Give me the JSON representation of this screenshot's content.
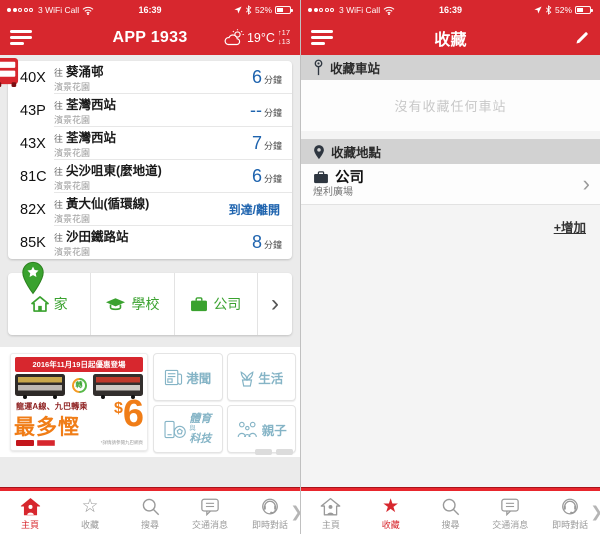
{
  "colors": {
    "brand_red": "#d7272e",
    "eta_blue": "#1e63ae",
    "green": "#3aa22f",
    "tile_blue": "#85b4c6",
    "banner_orange": "#f07d17"
  },
  "status": {
    "carrier": "3 WiFi Call",
    "time": "16:39",
    "battery": "52%"
  },
  "left": {
    "nav": {
      "title": "APP 1933",
      "temp": "19°C",
      "high": "↑17",
      "low": "↓13"
    },
    "routes": [
      {
        "number": "40X",
        "prefix": "往",
        "destination": "葵涌邨",
        "origin": "濱景花園",
        "eta": "6",
        "unit": "分鐘"
      },
      {
        "number": "43P",
        "prefix": "往",
        "destination": "荃灣西站",
        "origin": "濱景花園",
        "eta": "--",
        "unit": "分鐘"
      },
      {
        "number": "43X",
        "prefix": "往",
        "destination": "荃灣西站",
        "origin": "濱景花園",
        "eta": "7",
        "unit": "分鐘"
      },
      {
        "number": "81C",
        "prefix": "往",
        "destination": "尖沙咀東(麼地道)",
        "origin": "濱景花園",
        "eta": "6",
        "unit": "分鐘"
      },
      {
        "number": "82X",
        "prefix": "往",
        "destination": "黃大仙(循環線)",
        "origin": "濱景花園",
        "eta": "到達/離開",
        "unit": ""
      },
      {
        "number": "85K",
        "prefix": "往",
        "destination": "沙田鐵路站",
        "origin": "濱景花園",
        "eta": "8",
        "unit": "分鐘"
      }
    ],
    "shortcuts": [
      {
        "icon": "home-icon",
        "label": "家"
      },
      {
        "icon": "school-icon",
        "label": "學校"
      },
      {
        "icon": "briefcase-icon",
        "label": "公司"
      }
    ],
    "banner": {
      "headline": "2016年11月19日起優惠登場",
      "badge": "轉",
      "subline": "龍運A線、九巴轉乘",
      "tagline": "最多慳",
      "currency": "$",
      "price": "6",
      "disclaimer": "*詳情請參閱九巴網頁"
    },
    "tiles": [
      {
        "label": "港聞",
        "icon": "newspaper-icon"
      },
      {
        "label": "生活",
        "icon": "plant-icon"
      },
      {
        "top": "體育",
        "mid": "與",
        "bottom": "科技",
        "icon": "phone-ball-icon"
      },
      {
        "label": "親子",
        "icon": "family-icon"
      }
    ]
  },
  "right": {
    "nav": {
      "title": "收藏"
    },
    "stations_section": {
      "title": "收藏車站",
      "empty": "沒有收藏任何車站"
    },
    "places_section": {
      "title": "收藏地點",
      "item_title": "公司",
      "item_subtitle": "煌利廣場",
      "add": "+增加"
    }
  },
  "tabbar": {
    "items": [
      {
        "label": "主頁"
      },
      {
        "label": "收藏"
      },
      {
        "label": "搜尋"
      },
      {
        "label": "交通消息"
      },
      {
        "label": "即時對話"
      }
    ]
  },
  "icons": {
    "menu": "hamburger",
    "edit": "pencil",
    "weather": "sun-cloud",
    "station": "bus-stop-pin",
    "place": "map-pin",
    "company": "briefcase",
    "chevron": "›",
    "tabs": [
      "home",
      "star",
      "search",
      "chat-lines",
      "headset"
    ]
  }
}
